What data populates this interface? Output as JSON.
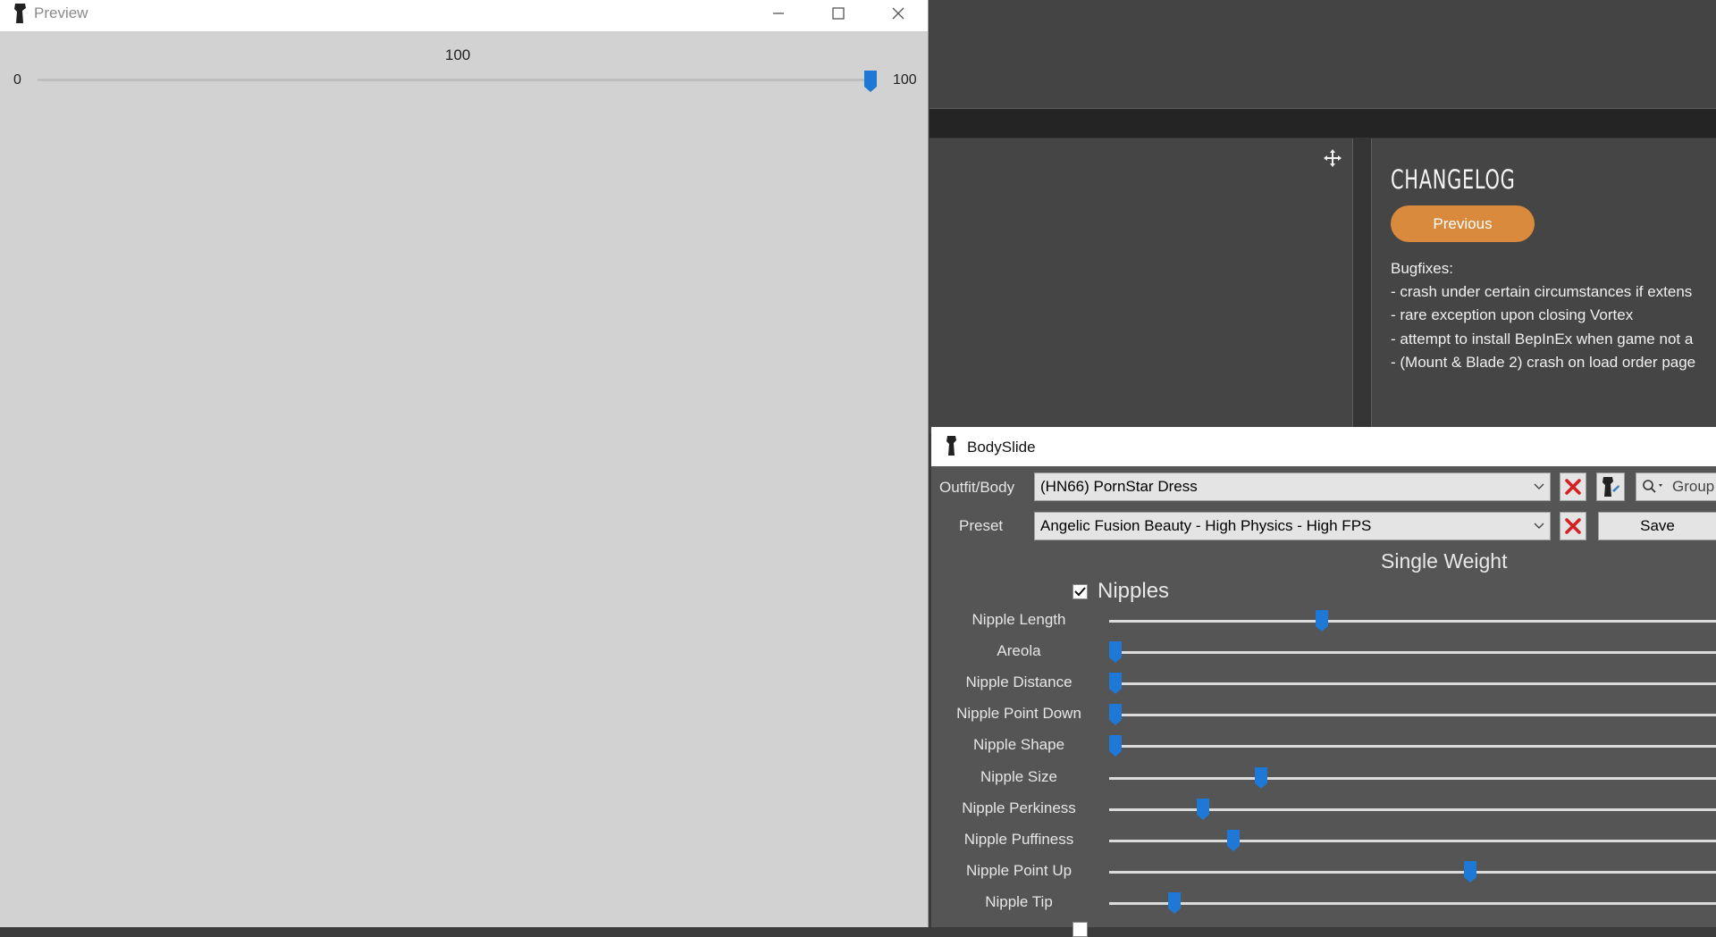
{
  "preview": {
    "title": "Preview",
    "slider": {
      "value_label": "100",
      "min_label": "0",
      "max_label": "100",
      "value": 100,
      "min": 0,
      "max": 100
    }
  },
  "vortex": {
    "changelog": {
      "heading": "CHANGELOG",
      "previous_button": "Previous",
      "section": "Bugfixes:",
      "items": [
        "- crash under certain circumstances if extens",
        "- rare exception upon closing Vortex",
        "- attempt to install BepInEx when game not a",
        "- (Mount & Blade 2) crash on load order page"
      ]
    },
    "accent_color": "#d98a3c"
  },
  "bodyslide": {
    "title": "BodySlide",
    "outfit_label": "Outfit/Body",
    "outfit_value": "(HN66) PornStar Dress",
    "preset_label": "Preset",
    "preset_value": "Angelic Fusion Beauty - High Physics - High FPS",
    "group_placeholder": "Group",
    "save_label": "Save",
    "weight_title": "Single Weight",
    "category": {
      "label": "Nipples",
      "checked": true
    },
    "sliders": [
      {
        "label": "Nipple Length",
        "value": 0.35
      },
      {
        "label": "Areola",
        "value": 0.01
      },
      {
        "label": "Nipple Distance",
        "value": 0.01
      },
      {
        "label": "Nipple Point Down",
        "value": 0.01
      },
      {
        "label": "Nipple Shape",
        "value": 0.01
      },
      {
        "label": "Nipple Size",
        "value": 0.25
      },
      {
        "label": "Nipple Perkiness",
        "value": 0.155
      },
      {
        "label": "Nipple Puffiness",
        "value": 0.205
      },
      {
        "label": "Nipple Point Up",
        "value": 0.595
      },
      {
        "label": "Nipple Tip",
        "value": 0.107
      }
    ],
    "slider_color": "#1e78d6",
    "close_color": "#d42020"
  }
}
